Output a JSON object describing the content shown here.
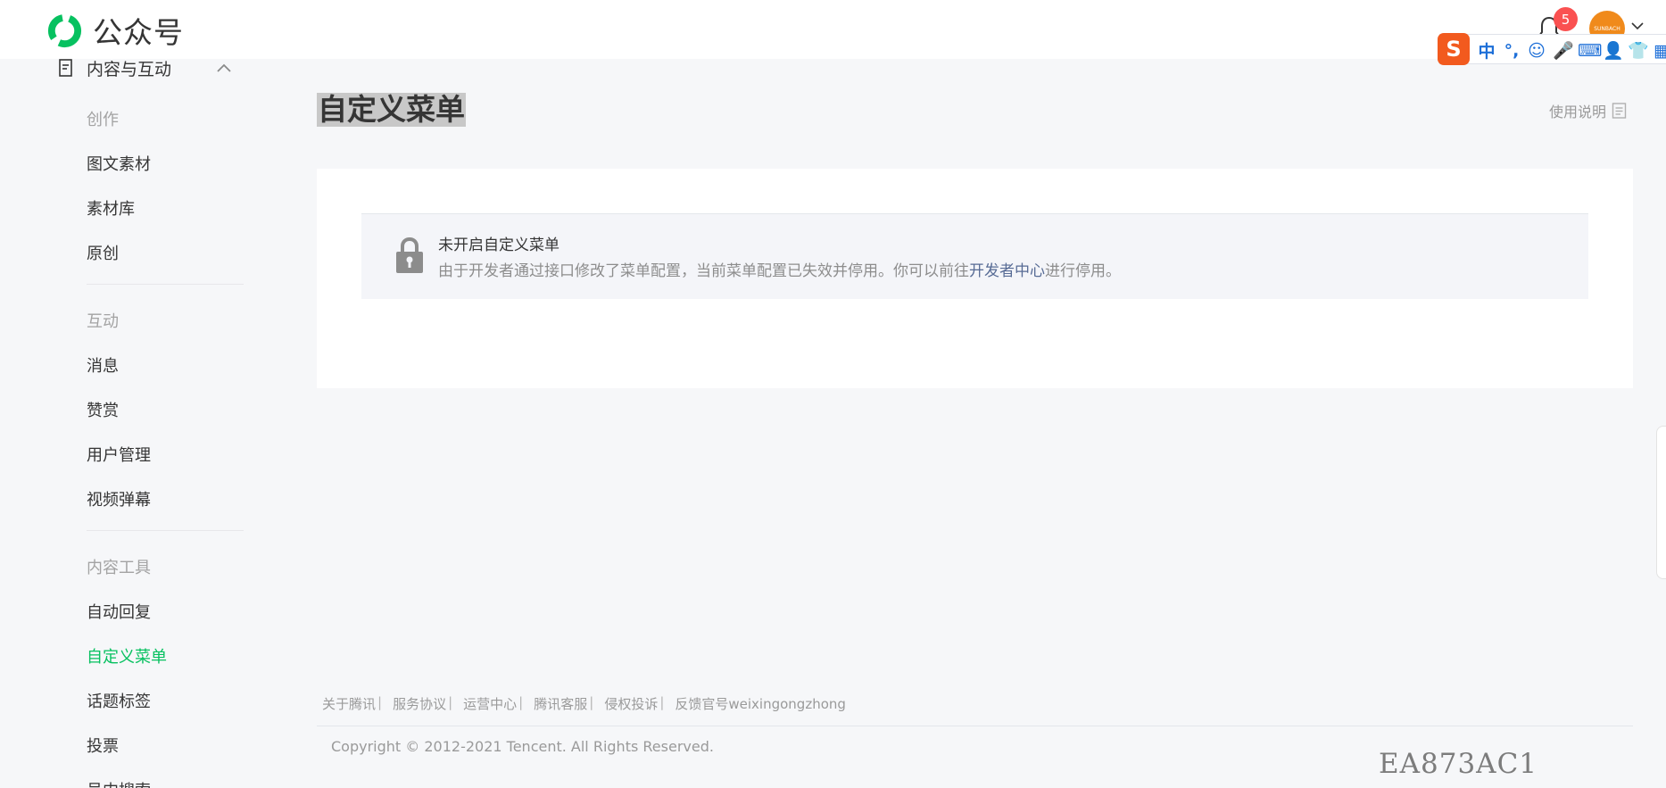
{
  "header": {
    "brand": "公众号",
    "notification_count": "5",
    "avatar_text": "SUNBACH"
  },
  "ime": {
    "logo": "S",
    "items": [
      "中",
      "°,",
      "☺",
      "🎤",
      "⌨",
      "👤",
      "👕",
      "▦"
    ]
  },
  "sidebar": {
    "section_title": "内容与互动",
    "groups": [
      {
        "category": "创作",
        "items": [
          "图文素材",
          "素材库",
          "原创"
        ]
      },
      {
        "category": "互动",
        "items": [
          "消息",
          "赞赏",
          "用户管理",
          "视频弹幕"
        ]
      },
      {
        "category": "内容工具",
        "items": [
          "自动回复",
          "自定义菜单",
          "话题标签",
          "投票",
          "号内搜索"
        ]
      }
    ],
    "active_item": "自定义菜单"
  },
  "main": {
    "title": "自定义菜单",
    "usage_label": "使用说明",
    "notice": {
      "title": "未开启自定义菜单",
      "desc_before": "由于开发者通过接口修改了菜单配置，当前菜单配置已失效并停用。你可以前往",
      "link": "开发者中心",
      "desc_after": "进行停用。"
    }
  },
  "footer": {
    "links": [
      "关于腾讯",
      "服务协议",
      "运营中心",
      "腾讯客服",
      "侵权投诉",
      "反馈官号weixingongzhong"
    ],
    "copyright": "Copyright © 2012-2021 Tencent. All Rights Reserved."
  },
  "overlay": {
    "code": "EA873AC1"
  },
  "colors": {
    "accent": "#07c160",
    "link": "#576b95",
    "badge": "#fa5151"
  }
}
